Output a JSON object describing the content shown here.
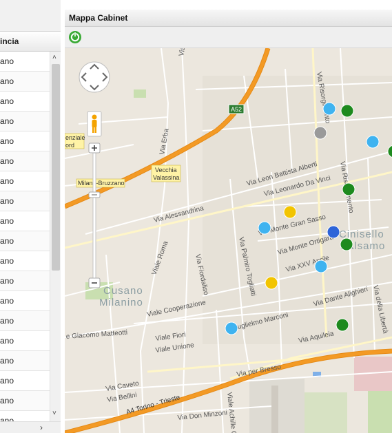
{
  "grid": {
    "column_header": "incia",
    "rows": [
      "ano",
      "ano",
      "ano",
      "ano",
      "ano",
      "ano",
      "ano",
      "ano",
      "ano",
      "ano",
      "ano",
      "ano",
      "ano",
      "ano",
      "ano",
      "ano",
      "ano",
      "ano",
      "ano"
    ]
  },
  "map_panel": {
    "title": "Mappa Cabinet",
    "refresh_icon": "refresh-power-icon"
  },
  "map": {
    "highway_badge": "A52",
    "places": {
      "cusano_line1": "Cusano",
      "cusano_line2": "Milanino",
      "cinisello_line1": "Cinisello",
      "cinisello_line2": "Balsamo",
      "station": "Milano-Bruzzano",
      "vecchia_line1": "Vecchia",
      "vecchia_line2": "Valassina",
      "enziale_line1": "enziale",
      "enziale_line2": "ord"
    },
    "streets": {
      "erba": "Via Erba",
      "risorgimento_top": "Via Risorgimento",
      "risorgimento_mid": "Via Risorgimento",
      "alberti": "Via Leon Battista Alberti",
      "da_vinci": "Via Leonardo Da Vinci",
      "alessandrina": "Via Alessandrina",
      "gran_sasso": "Via Monte Gran Sasso",
      "ortigara": "Via Monte Ortigara",
      "xxv_aprile": "Via XXV Aprile",
      "palmiro": "Via Palmiro Togliatti",
      "roma": "Viale Roma",
      "fiordaliso": "Via Fiordaliso",
      "cooperazione": "Viale Cooperazione",
      "marconi": "Guglielmo Marconi",
      "aquileia": "Via Aquileia",
      "dante": "Via Dante Alighieri",
      "liberta": "Via della Libertà",
      "matteotti": "e Giacomo Matteotti",
      "fiori": "Viale Fiori",
      "unione": "Viale Unione",
      "per_bresso": "Via per Bresso",
      "caveto": "Via Caveto",
      "bellini": "Via Bellini",
      "don_minzoni": "Via Don Minzoni",
      "achille": "Viale Achille G",
      "a4": "A4 Torino - Trieste",
      "top_v": "Via"
    },
    "markers": [
      {
        "color": "cyan"
      },
      {
        "color": "green"
      },
      {
        "color": "gray"
      },
      {
        "color": "cyan"
      },
      {
        "color": "green"
      },
      {
        "color": "green"
      },
      {
        "color": "yellow"
      },
      {
        "color": "cyan"
      },
      {
        "color": "blue"
      },
      {
        "color": "green"
      },
      {
        "color": "cyan"
      },
      {
        "color": "yellow"
      },
      {
        "color": "cyan"
      },
      {
        "color": "green"
      }
    ]
  },
  "colors": {
    "highway": "#f39a25",
    "marker_cyan": "#3fb3f0",
    "marker_green": "#1e8a1e",
    "marker_gray": "#9a9a9a",
    "marker_yellow": "#f2c400",
    "marker_blue": "#2e64d8",
    "refresh_green": "#3aaa35"
  }
}
